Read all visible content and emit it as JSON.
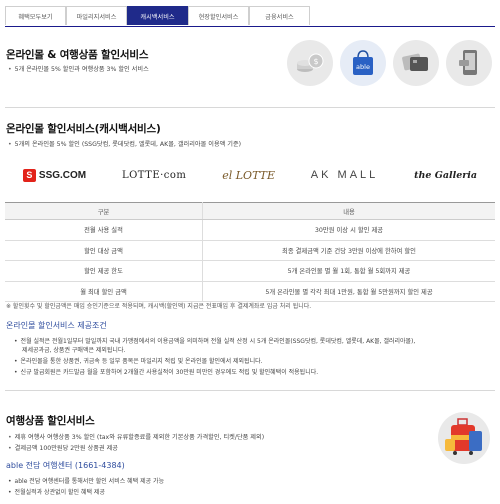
{
  "tabs": [
    {
      "label": "혜택모두보기"
    },
    {
      "label": "마일리지서비스"
    },
    {
      "label": "캐시백서비스",
      "active": true
    },
    {
      "label": "현장할인서비스"
    },
    {
      "label": "금융서비스"
    }
  ],
  "section1": {
    "title": "온라인몰 & 여행상품 할인서비스",
    "bullet": "5개 온라인몰 5% 할인과 여행상품 3% 할인 서비스",
    "icons": [
      "coins-icon",
      "shopping-bag-icon",
      "cards-icon",
      "smartphone-icon"
    ],
    "bag_label": "able"
  },
  "section2": {
    "title": "온라인몰 할인서비스(캐시백서비스)",
    "bullet": "5개의 온라인몰 5% 할인 (SSG닷컴, 롯데닷컴, 엘롯데, AK몰, 갤러리아몰 이용액 기준)",
    "logos": [
      "SSG.COM",
      "LOTTE·com",
      "el LOTTE",
      "AK MALL",
      "the Galleria"
    ]
  },
  "table": {
    "headers": [
      "구분",
      "내용"
    ],
    "rows": [
      [
        "전월 사용 실적",
        "30만원 이상 시 할인 제공"
      ],
      [
        "할인 대상 금액",
        "최종 결제금액 기준 건당 3만원 이상에 한하여 할인"
      ],
      [
        "할인 제공 한도",
        "5개 온라인몰 별 월 1회, 통합 월 5회까지 제공"
      ],
      [
        "월 최대 할인 금액",
        "5개 온라인몰 별 각각 최대 1만원, 통합 월 5만원까지 할인 제공"
      ]
    ]
  },
  "note": "※ 할인횟수 및 할인금액은 매입 승인기준으로 적용되며, 캐시백(할인액) 지급은 전표매입 후 결제계좌로 입금 처리 됩니다.",
  "conditions": {
    "title": "온라인몰 할인서비스 제공조건",
    "items": [
      "전월 실적은 전월1일부터 말일까지 국내 가맹점에서의 이용금액을 의미하며 전월 실적 산정 시 5개 온라인몰(SSG닷컴, 롯데닷컴, 엘롯데, AK몰, 갤러리아몰),",
      "제세공과금, 상품권 구매액은 제외됩니다.",
      "온라인몰을 통한 상품권, 귀금속 등 일부 품목은 마일리지 적립 및 온라인몰 할인에서 제외됩니다.",
      "신규 발급회원은 카드발급 월을 포함하여 2개월간 사용실적이 30만원 미만인 경우에도 적립 및 할인혜택이 적용됩니다."
    ]
  },
  "section3": {
    "title": "여행상품 할인서비스",
    "bullets": [
      "제휴 여행사 여행상품 3% 할인 (tax와 유류할증료를 제외한 기본상품 가격할인, 티켓/단품 제외)",
      "결제금액 100만원당 2만원 상품권 제공"
    ],
    "center": "able 전담 여행센터 (1661-4384)",
    "center_items": [
      "able 전담 여행센터를 통해서만 할인 서비스 혜택 제공 가능",
      "전월실적과 상관없이 할인 혜택 제공"
    ]
  }
}
